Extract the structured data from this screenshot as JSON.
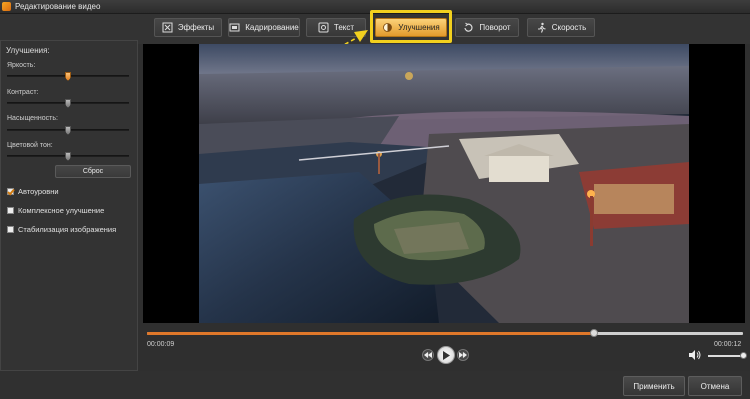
{
  "window": {
    "title": "Редактирование видео"
  },
  "tabs": [
    {
      "label": "Эффекты",
      "icon": "effects-icon"
    },
    {
      "label": "Кадрирование",
      "icon": "crop-icon"
    },
    {
      "label": "Текст",
      "icon": "text-icon"
    },
    {
      "label": "Улучшения",
      "icon": "enhance-icon",
      "active": true
    },
    {
      "label": "Поворот",
      "icon": "rotate-icon"
    },
    {
      "label": "Скорость",
      "icon": "speed-icon"
    }
  ],
  "enhancements": {
    "title": "Улучшения:",
    "sliders": [
      {
        "label": "Яркость:",
        "value": 0.5
      },
      {
        "label": "Контраст:",
        "value": 0.5
      },
      {
        "label": "Насыщенность:",
        "value": 0.5
      },
      {
        "label": "Цветовой тон:",
        "value": 0.5
      }
    ],
    "reset_label": "Сброс",
    "options": [
      {
        "label": "Автоуровни",
        "checked": true
      },
      {
        "label": "Комплексное улучшение",
        "checked": false
      },
      {
        "label": "Стабилизация изображения",
        "checked": false
      }
    ]
  },
  "player": {
    "current_time": "00:00:09",
    "total_time": "00:00:12",
    "progress": 0.75,
    "volume": 1.0
  },
  "footer": {
    "apply_label": "Применить",
    "cancel_label": "Отмена"
  },
  "colors": {
    "accent": "#e0782a",
    "highlight": "#f2d01e",
    "active_tab": "#f3b24c"
  }
}
